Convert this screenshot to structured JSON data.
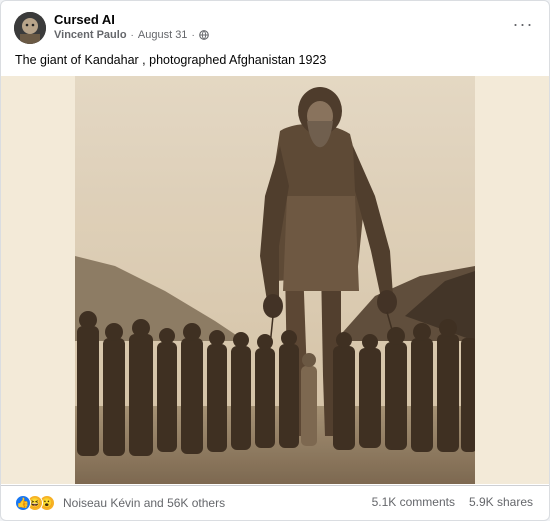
{
  "post": {
    "group_name": "Cursed AI",
    "author": "Vincent Paulo",
    "date": "August 31",
    "separator": "·",
    "privacy_icon": "globe-icon",
    "more_icon": "more-options-icon",
    "more_label": "···",
    "caption": "The giant of Kandahar , photographed Afghanistan 1923",
    "image_subject": "sepia photograph of a giant figure standing among a crowd of men in a mountain valley"
  },
  "footer": {
    "reaction_icons": [
      "like-icon",
      "haha-icon",
      "wow-icon"
    ],
    "reaction_summary": "Noiseau Kévin and 56K others",
    "comments": "5.1K comments",
    "shares": "5.9K shares"
  },
  "colors": {
    "text_primary": "#050505",
    "text_secondary": "#65676b",
    "like_blue": "#1877f2",
    "sepia_light": "#e9dcc3",
    "sepia_dark": "#3a2d20"
  }
}
